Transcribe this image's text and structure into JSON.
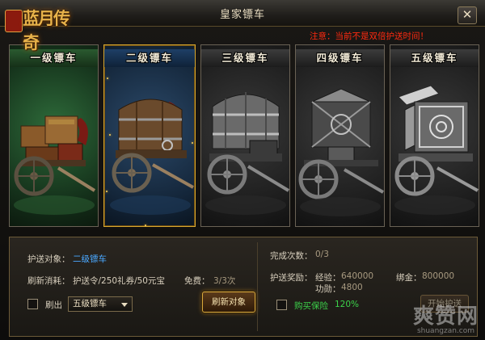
{
  "window": {
    "title": "皇家镖车",
    "close_symbol": "✕",
    "notice": "注意：当前不是双倍护送时间！"
  },
  "logo": {
    "text": "蓝月传奇"
  },
  "carts": [
    {
      "label": "一级镖车",
      "style": "green",
      "selected": false
    },
    {
      "label": "二级镖车",
      "style": "blue",
      "selected": true
    },
    {
      "label": "三级镖车",
      "style": "gray",
      "selected": false
    },
    {
      "label": "四级镖车",
      "style": "gray",
      "selected": false
    },
    {
      "label": "五级镖车",
      "style": "gray",
      "selected": false
    }
  ],
  "left_panel": {
    "target_label": "护送对象：",
    "target_value": "二级镖车",
    "cost_label": "刷新消耗：",
    "cost_value": "护送令/250礼券/50元宝",
    "free_label": "免费：",
    "free_value": "3/3次",
    "brush_label": "刷出",
    "brush_select": "五级镖车",
    "refresh_button": "刷新对象"
  },
  "right_panel": {
    "done_label": "完成次数：",
    "done_value": "0/3",
    "reward_label": "护送奖励：",
    "exp_label": "经验：",
    "exp_value": "640000",
    "gold_label": "绑金：",
    "gold_value": "800000",
    "merit_label": "功勋：",
    "merit_value": "4800",
    "insurance_label": "购买保险",
    "insurance_value": "120%",
    "start_button": "开始护送"
  },
  "watermark": {
    "logo": "爽赞网",
    "url": "shuangzan.com"
  },
  "colors": {
    "accent_gold": "#d9a83a",
    "notice_red": "#ff2a10",
    "link_blue": "#4aa8ff",
    "insurance_green": "#3cd24a"
  }
}
